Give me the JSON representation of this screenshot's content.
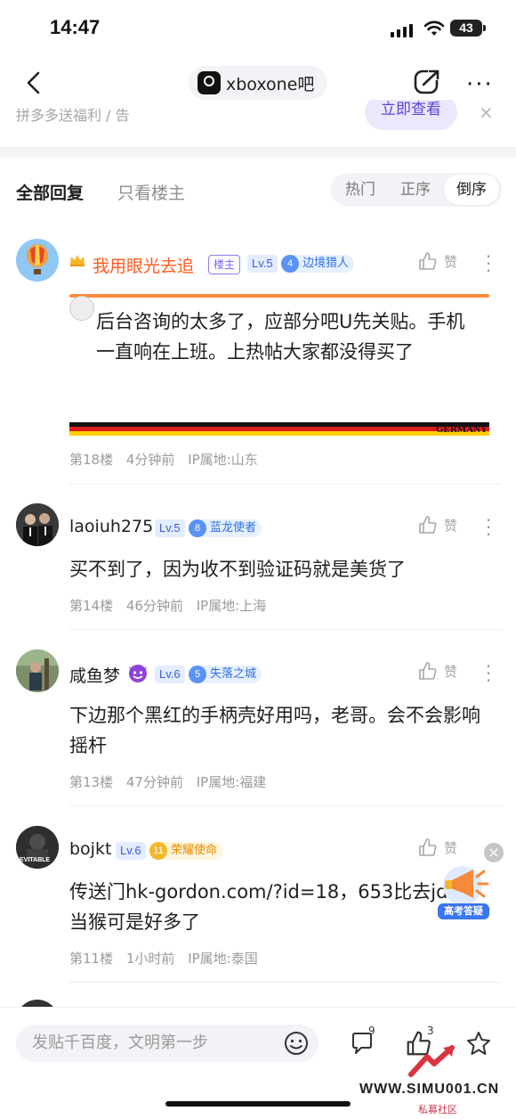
{
  "status": {
    "time": "14:47",
    "battery": "43"
  },
  "header": {
    "forum_name": "xboxone吧",
    "more": "···"
  },
  "ad": {
    "text": "拼多多送福利 / 告",
    "button": "立即查看",
    "close": "×"
  },
  "tabs": {
    "all": "全部回复",
    "op_only": "只看楼主",
    "sort": [
      "热门",
      "正序",
      "倒序"
    ],
    "sort_selected": "倒序"
  },
  "like_label": "赞",
  "posts": [
    {
      "username": "我用眼光去追",
      "op_badge": "楼主",
      "level": "Lv.5",
      "medal_num": "4",
      "medal_name": "边境猎人",
      "content": "后台咨询的太多了，应部分吧U先关贴。手机一直响在上班。上热帖大家都没得买了",
      "frame_text": "GERMANY",
      "floor": "第18楼",
      "time": "4分钟前",
      "ip": "IP属地:山东"
    },
    {
      "username": "laoiuh275",
      "level": "Lv.5",
      "medal_num": "8",
      "medal_name": "蓝龙使者",
      "content": "买不到了，因为收不到验证码就是美货了",
      "floor": "第14楼",
      "time": "46分钟前",
      "ip": "IP属地:上海"
    },
    {
      "username": "咸鱼梦",
      "level": "Lv.6",
      "medal_num": "5",
      "medal_name": "失落之城",
      "content": "下边那个黑红的手柄壳好用吗，老哥。会不会影响摇杆",
      "floor": "第13楼",
      "time": "47分钟前",
      "ip": "IP属地:福建"
    },
    {
      "username": "bojkt",
      "level": "Lv.6",
      "medal_num": "11",
      "medal_name": "荣耀使命",
      "content": "传送门hk-gordon.com/?id=18，653比去jd当猴可是好多了",
      "avatar_text": "EVITABLE",
      "floor": "第11楼",
      "time": "1小时前",
      "ip": "IP属地:泰国"
    }
  ],
  "floating": {
    "label": "高考答疑",
    "close": "×"
  },
  "bottom": {
    "placeholder": "发贴千百度，文明第一步",
    "comment_count": "9",
    "like_count": "3"
  },
  "watermark": {
    "site": "WWW.SIMU001.CN",
    "sub": "私募社区"
  }
}
